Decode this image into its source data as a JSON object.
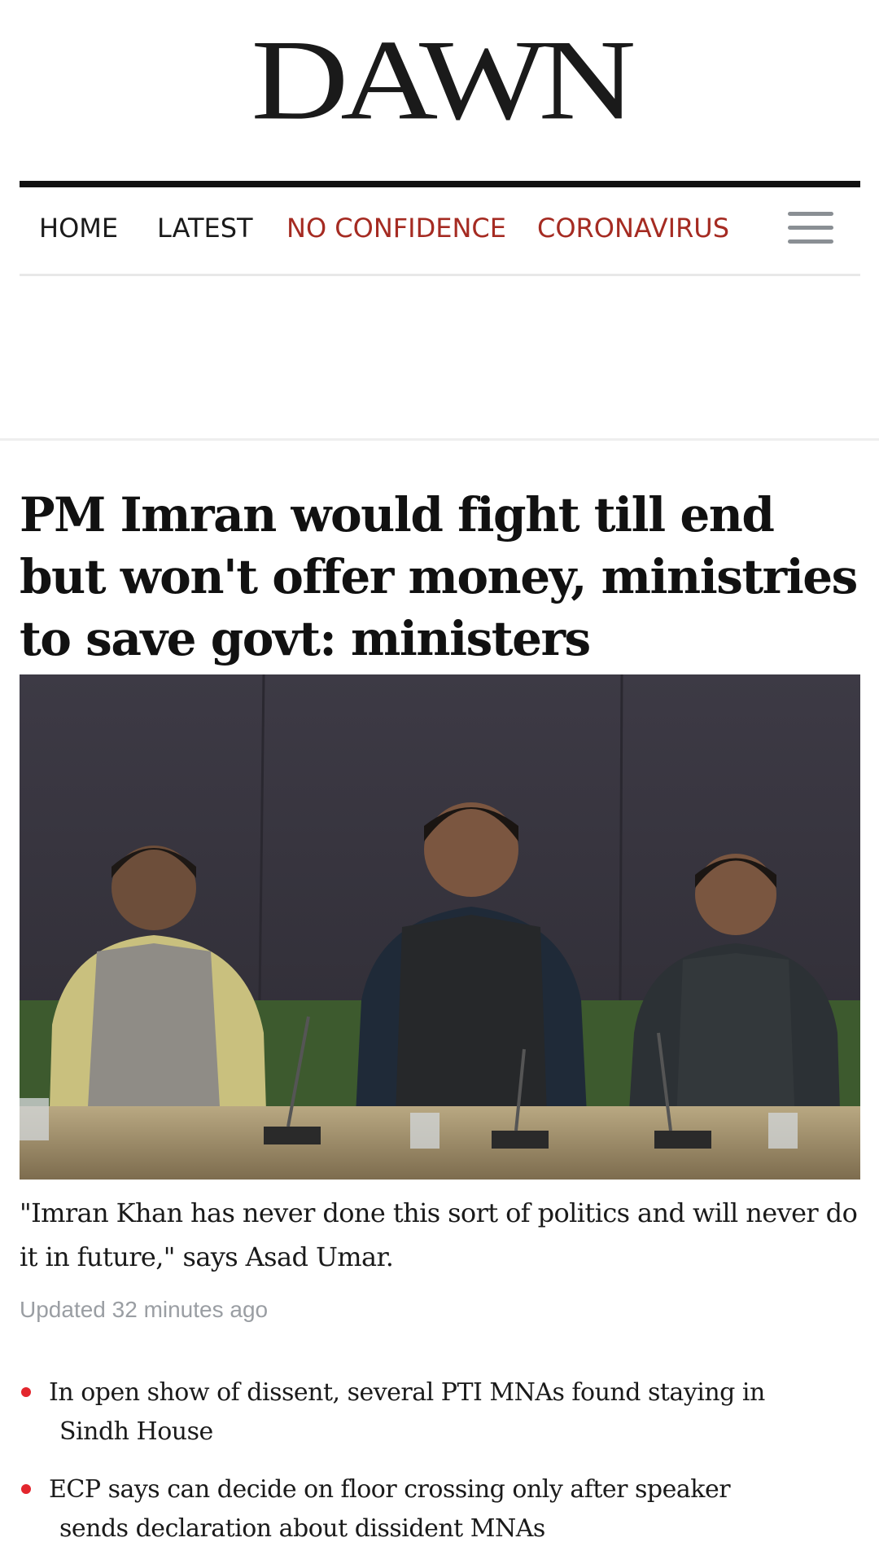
{
  "site": {
    "logo": "DAWN"
  },
  "nav": {
    "items": [
      {
        "label": "HOME",
        "color": "#1a1a1a"
      },
      {
        "label": "LATEST",
        "color": "#1a1a1a"
      },
      {
        "label": "NO CONFIDENCE",
        "color": "#a52b22"
      },
      {
        "label": "CORONAVIRUS",
        "color": "#a52b22"
      }
    ],
    "menu_icon": "hamburger-menu-icon"
  },
  "article": {
    "headline": "PM Imran would fight till end but won't offer money, ministries to save govt: ministers",
    "image_description_icon": "press-conference-photo",
    "summary": "\"Imran Khan has never done this sort of politics and will never do it in future,\" says Asad Umar.",
    "updated": "Updated 32 minutes ago"
  },
  "related": {
    "bullet_color": "#e3262d",
    "items": [
      {
        "text": "In open show of dissent, several PTI MNAs found staying in Sindh House"
      },
      {
        "text": "ECP says can decide on floor crossing only after speaker sends declaration about dissident MNAs"
      }
    ]
  }
}
